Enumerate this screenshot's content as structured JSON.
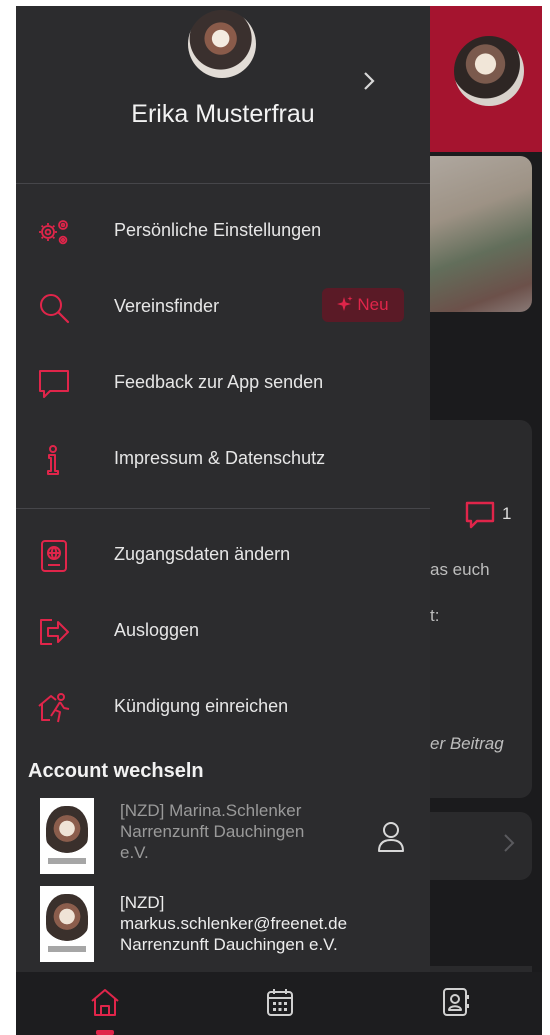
{
  "profile": {
    "name": "Erika Musterfrau"
  },
  "menu": [
    {
      "label": "Persönliche Einstellungen",
      "icon": "gears-icon"
    },
    {
      "label": "Vereinsfinder",
      "icon": "search-icon",
      "badge": "Neu"
    },
    {
      "label": "Feedback zur App senden",
      "icon": "chat-bubble-icon"
    },
    {
      "label": "Impressum & Datenschutz",
      "icon": "info-icon"
    },
    {
      "label": "Zugangsdaten ändern",
      "icon": "id-card-icon"
    },
    {
      "label": "Ausloggen",
      "icon": "logout-icon"
    },
    {
      "label": "Kündigung einreichen",
      "icon": "house-exit-icon"
    }
  ],
  "accounts": {
    "title": "Account wechseln",
    "items": [
      {
        "line1": "[NZD] Marina.Schlenker",
        "line2": "Narrenzunft Dauchingen",
        "line3": "e.V."
      },
      {
        "line1": "[NZD]",
        "line2": "markus.schlenker@freenet.de",
        "line3": "Narrenzunft Dauchingen e.V."
      }
    ]
  },
  "background": {
    "comment_count": "1",
    "snippet1": "as euch",
    "snippet2": "t:",
    "snippet3": "er Beitrag"
  },
  "tabs": [
    {
      "icon": "home-icon",
      "active": true
    },
    {
      "icon": "calendar-icon",
      "active": false
    },
    {
      "icon": "contacts-icon",
      "active": false
    }
  ],
  "colors": {
    "accent": "#e0254a",
    "drawer_bg": "#2c2c2e",
    "header_red": "#a5142f"
  }
}
